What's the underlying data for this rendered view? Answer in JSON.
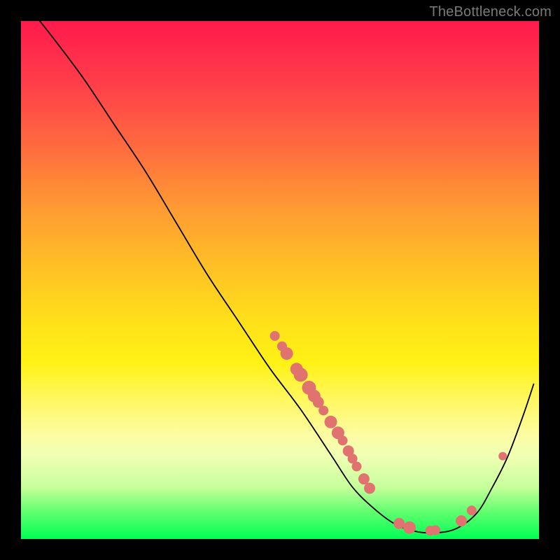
{
  "attribution": "TheBottleneck.com",
  "chart_data": {
    "type": "line",
    "title": "",
    "xlabel": "",
    "ylabel": "",
    "xlim": [
      0,
      1
    ],
    "ylim": [
      0,
      1
    ],
    "series": [
      {
        "name": "curve",
        "points": [
          {
            "x": 0.02,
            "y": 1.02
          },
          {
            "x": 0.06,
            "y": 0.97
          },
          {
            "x": 0.12,
            "y": 0.89
          },
          {
            "x": 0.18,
            "y": 0.8
          },
          {
            "x": 0.24,
            "y": 0.71
          },
          {
            "x": 0.3,
            "y": 0.61
          },
          {
            "x": 0.36,
            "y": 0.51
          },
          {
            "x": 0.42,
            "y": 0.42
          },
          {
            "x": 0.48,
            "y": 0.33
          },
          {
            "x": 0.54,
            "y": 0.25
          },
          {
            "x": 0.6,
            "y": 0.16
          },
          {
            "x": 0.64,
            "y": 0.1
          },
          {
            "x": 0.68,
            "y": 0.06
          },
          {
            "x": 0.72,
            "y": 0.03
          },
          {
            "x": 0.76,
            "y": 0.015
          },
          {
            "x": 0.8,
            "y": 0.012
          },
          {
            "x": 0.84,
            "y": 0.02
          },
          {
            "x": 0.88,
            "y": 0.05
          },
          {
            "x": 0.91,
            "y": 0.1
          },
          {
            "x": 0.94,
            "y": 0.16
          },
          {
            "x": 0.97,
            "y": 0.24
          },
          {
            "x": 0.99,
            "y": 0.3
          }
        ]
      }
    ],
    "scatter": [
      {
        "x": 0.49,
        "y": 0.392,
        "r": 7
      },
      {
        "x": 0.504,
        "y": 0.372,
        "r": 7
      },
      {
        "x": 0.513,
        "y": 0.358,
        "r": 9
      },
      {
        "x": 0.532,
        "y": 0.328,
        "r": 9
      },
      {
        "x": 0.54,
        "y": 0.317,
        "r": 10
      },
      {
        "x": 0.556,
        "y": 0.292,
        "r": 10
      },
      {
        "x": 0.566,
        "y": 0.276,
        "r": 9
      },
      {
        "x": 0.574,
        "y": 0.264,
        "r": 8
      },
      {
        "x": 0.584,
        "y": 0.248,
        "r": 7
      },
      {
        "x": 0.598,
        "y": 0.226,
        "r": 9
      },
      {
        "x": 0.612,
        "y": 0.205,
        "r": 9
      },
      {
        "x": 0.621,
        "y": 0.19,
        "r": 7
      },
      {
        "x": 0.632,
        "y": 0.17,
        "r": 8
      },
      {
        "x": 0.64,
        "y": 0.155,
        "r": 7
      },
      {
        "x": 0.648,
        "y": 0.14,
        "r": 7
      },
      {
        "x": 0.662,
        "y": 0.116,
        "r": 8
      },
      {
        "x": 0.673,
        "y": 0.098,
        "r": 8
      },
      {
        "x": 0.73,
        "y": 0.03,
        "r": 8
      },
      {
        "x": 0.75,
        "y": 0.022,
        "r": 9
      },
      {
        "x": 0.79,
        "y": 0.016,
        "r": 7
      },
      {
        "x": 0.8,
        "y": 0.017,
        "r": 7
      },
      {
        "x": 0.85,
        "y": 0.035,
        "r": 8
      },
      {
        "x": 0.87,
        "y": 0.055,
        "r": 7
      },
      {
        "x": 0.93,
        "y": 0.16,
        "r": 6
      }
    ]
  }
}
